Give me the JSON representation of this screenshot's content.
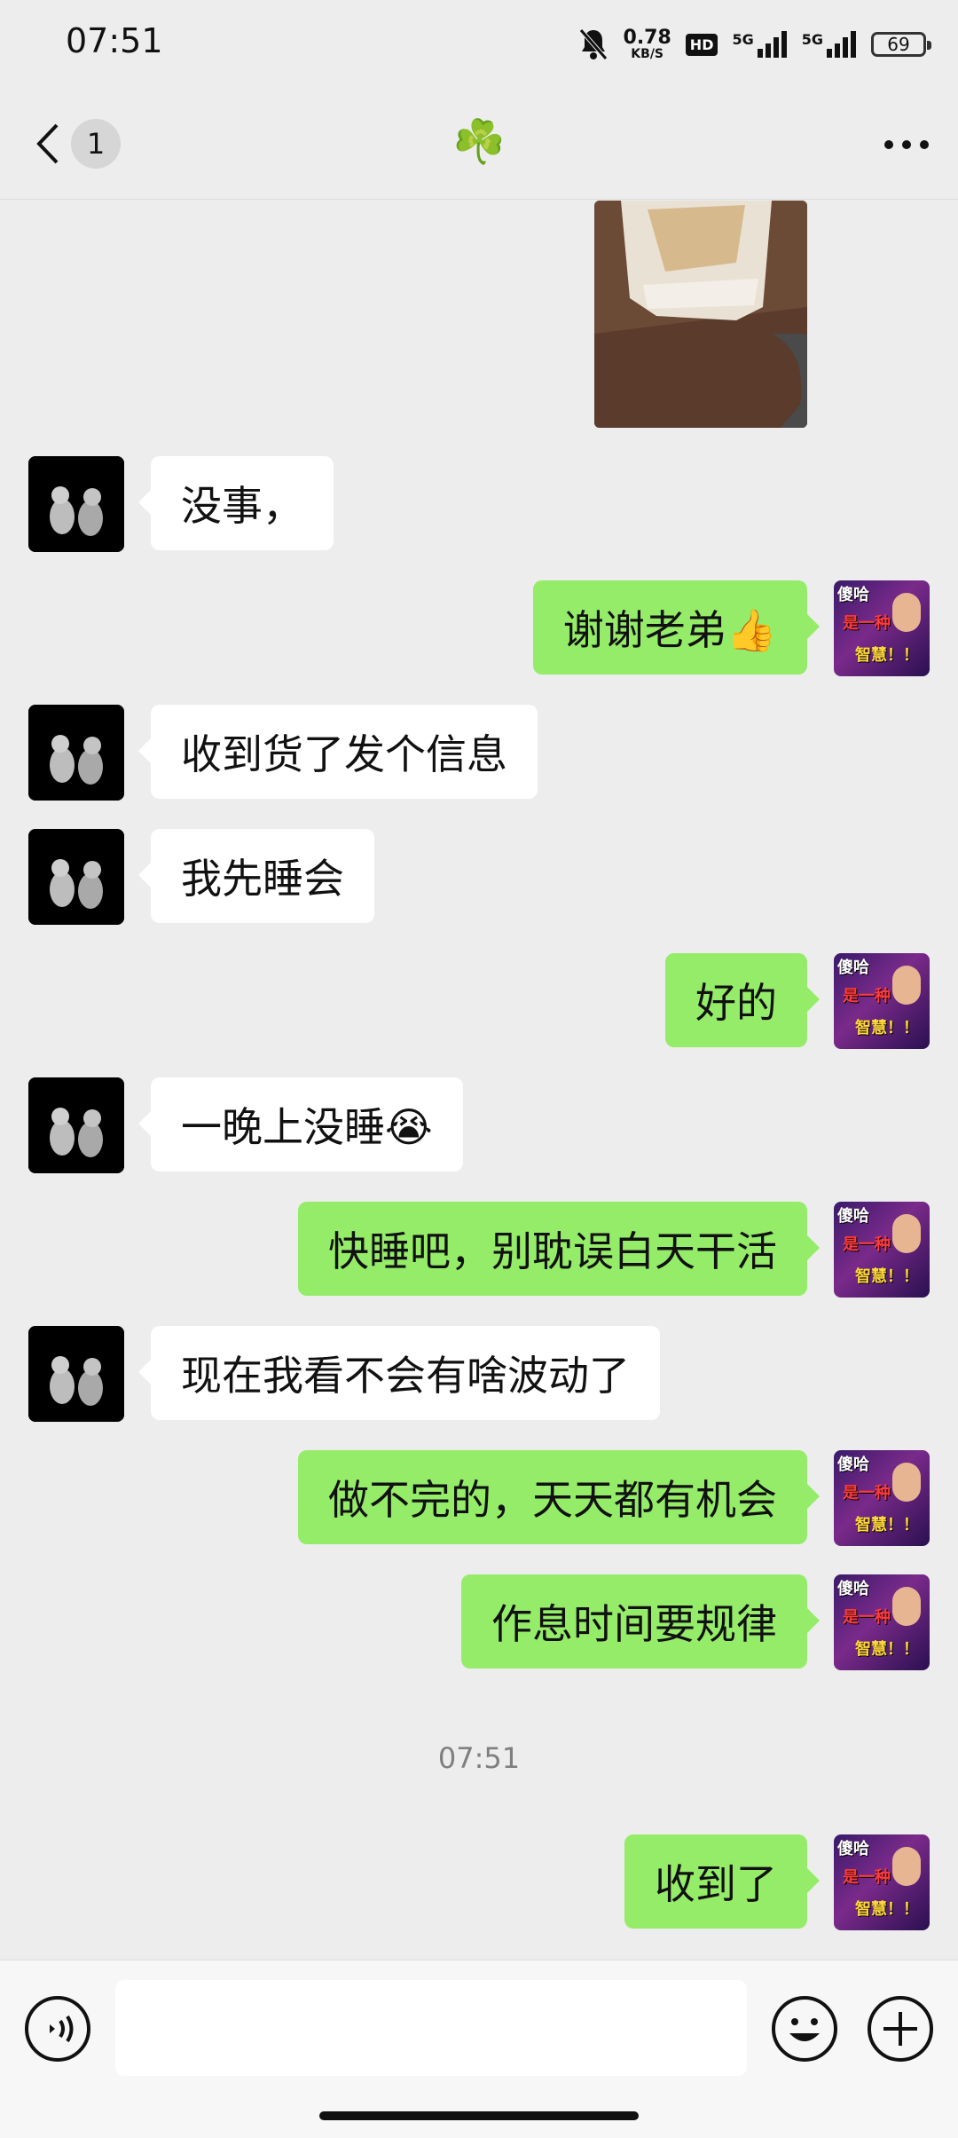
{
  "status_bar": {
    "time": "07:51",
    "network_speed": "0.78",
    "network_speed_unit": "KB/S",
    "hd_badge": "HD",
    "signal_1_label": "5G",
    "signal_2_label": "5G",
    "battery": "69",
    "icons": [
      "mute-bell-icon",
      "signal-icon",
      "battery-icon"
    ]
  },
  "nav": {
    "unread_count": "1",
    "title": "☘️",
    "icons": [
      "back-chevron-icon",
      "more-dots-icon"
    ]
  },
  "messages": [
    {
      "side": "left",
      "text": "没事，"
    },
    {
      "side": "right",
      "text": "谢谢老弟👍"
    },
    {
      "side": "left",
      "text": "收到货了发个信息"
    },
    {
      "side": "left",
      "text": "我先睡会"
    },
    {
      "side": "right",
      "text": "好的"
    },
    {
      "side": "left",
      "text": "一晚上没睡😭"
    },
    {
      "side": "right",
      "text": "快睡吧，别耽误白天干活"
    },
    {
      "side": "left",
      "text": "现在我看不会有啥波动了"
    },
    {
      "side": "right",
      "text": "做不完的，天天都有机会"
    },
    {
      "side": "right",
      "text": "作息时间要规律"
    },
    {
      "side": "right",
      "text": "收到了"
    }
  ],
  "timestamp": "07:51",
  "self_avatar_caption": [
    "傻哈",
    "是一种",
    "智慧！！"
  ],
  "input": {
    "value": "",
    "icons": [
      "voice-icon",
      "emoji-icon",
      "plus-icon"
    ]
  },
  "colors": {
    "background": "#ededed",
    "self_bubble": "#95ec69",
    "other_bubble": "#ffffff"
  }
}
